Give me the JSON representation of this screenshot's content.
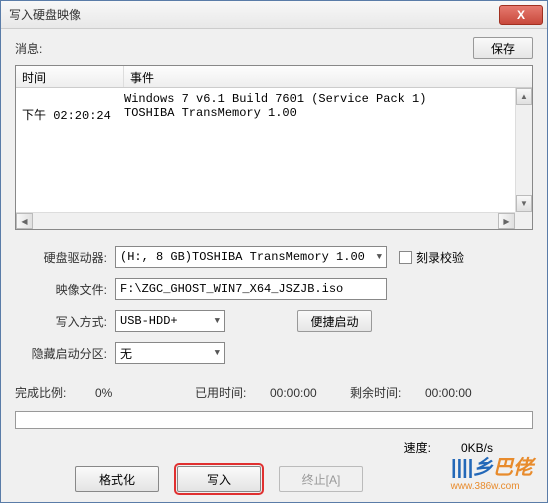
{
  "title": "写入硬盘映像",
  "close_x": "X",
  "message_label": "消息:",
  "save_label": "保存",
  "log": {
    "col_time": "时间",
    "col_event": "事件",
    "rows": [
      {
        "time": "",
        "event": "Windows 7 v6.1 Build 7601 (Service Pack 1)"
      },
      {
        "time": "下午 02:20:24",
        "event": "TOSHIBA TransMemory     1.00"
      }
    ]
  },
  "form": {
    "drive_label": "硬盘驱动器:",
    "drive_value": "(H:, 8 GB)TOSHIBA TransMemory     1.00",
    "verify_label": "刻录校验",
    "image_label": "映像文件:",
    "image_value": "F:\\ZGC_GHOST_WIN7_X64_JSZJB.iso",
    "mode_label": "写入方式:",
    "mode_value": "USB-HDD+",
    "quick_label": "便捷启动",
    "hide_label": "隐藏启动分区:",
    "hide_value": "无"
  },
  "progress": {
    "ratio_label": "完成比例:",
    "ratio_value": "0%",
    "elapsed_label": "已用时间:",
    "elapsed_value": "00:00:00",
    "remain_label": "剩余时间:",
    "remain_value": "00:00:00"
  },
  "speed": {
    "label": "速度:",
    "value": "0KB/s"
  },
  "buttons": {
    "format": "格式化",
    "write": "写入",
    "abort": "终止[A]"
  },
  "logo": {
    "brand1": "乡",
    "brand2": "巴佬",
    "url": "www.386w.com"
  }
}
